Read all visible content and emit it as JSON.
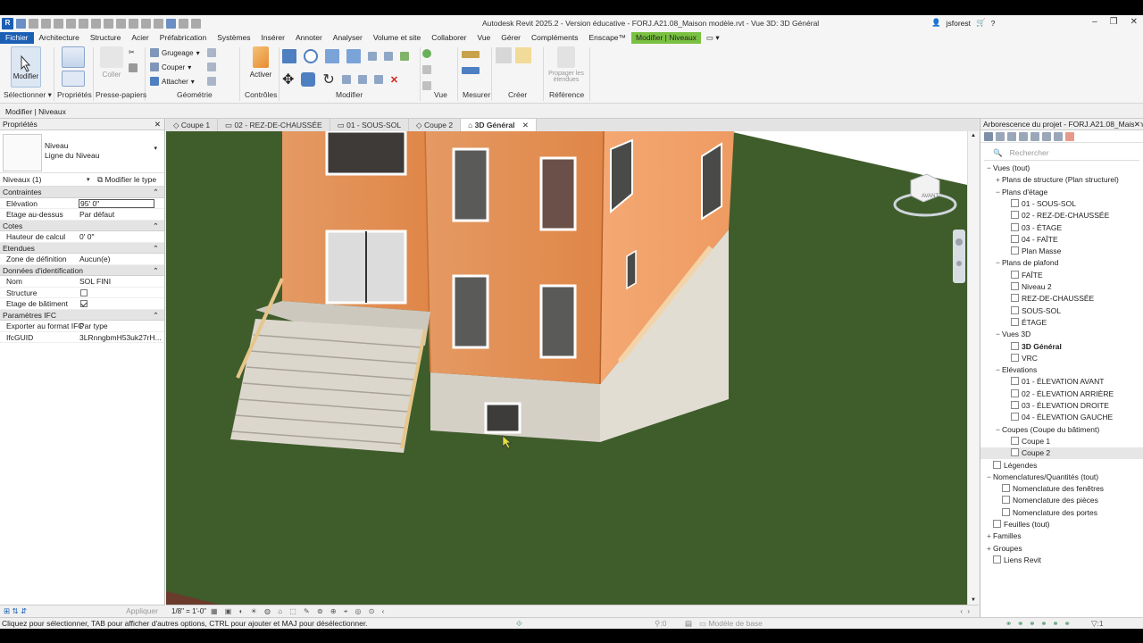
{
  "window": {
    "title": "Autodesk Revit 2025.2 - Version éducative - FORJ.A21.08_Maison modèle.rvt - Vue 3D: 3D Général",
    "user": "jsforest"
  },
  "menu": [
    "Fichier",
    "Architecture",
    "Structure",
    "Acier",
    "Préfabrication",
    "Systèmes",
    "Insérer",
    "Annoter",
    "Analyser",
    "Volume et site",
    "Collaborer",
    "Vue",
    "Gérer",
    "Compléments",
    "Enscape™",
    "Modifier | Niveaux"
  ],
  "ribbon": {
    "modify_label": "Modifier",
    "panels": [
      "Sélectionner",
      "Propriétés",
      "Presse-papiers",
      "Géométrie",
      "Contrôles",
      "Modifier",
      "Vue",
      "Mesurer",
      "Créer",
      "Référence"
    ],
    "geometry": {
      "cope": "Grugeage",
      "cut": "Couper",
      "join": "Attacher"
    },
    "activate": "Activer",
    "coller": "Coller",
    "propagate": "Propager les étendues"
  },
  "options_bar": "Modifier | Niveaux",
  "properties": {
    "title": "Propriétés",
    "type_family": "Niveau",
    "type_name": "Ligne du Niveau",
    "instance_filter": "Niveaux (1)",
    "edit_type": "Modifier le type",
    "sections": [
      {
        "name": "Contraintes",
        "rows": [
          {
            "k": "Elévation",
            "v": "95'  0\""
          },
          {
            "k": "Etage au-dessus",
            "v": "Par défaut"
          }
        ]
      },
      {
        "name": "Cotes",
        "rows": [
          {
            "k": "Hauteur de calcul",
            "v": "0'  0\""
          }
        ]
      },
      {
        "name": "Etendues",
        "rows": [
          {
            "k": "Zone de définition",
            "v": "Aucun(e)"
          }
        ]
      },
      {
        "name": "Données d'identification",
        "rows": [
          {
            "k": "Nom",
            "v": "SOL FINI"
          },
          {
            "k": "Structure",
            "v": ""
          },
          {
            "k": "Etage de bâtiment",
            "v": ""
          }
        ]
      },
      {
        "name": "Paramètres IFC",
        "rows": [
          {
            "k": "Exporter au format IFC",
            "v": "Par type"
          },
          {
            "k": "IfcGUID",
            "v": "3LRnngbmH53uk27rH..."
          }
        ]
      }
    ],
    "apply": "Appliquer"
  },
  "tabs": [
    "Coupe 1",
    "02 - REZ-DE-CHAUSSÉE",
    "01 - SOUS-SOL",
    "Coupe 2",
    "3D Général"
  ],
  "view": {
    "scale": "1/8\" = 1'-0\"",
    "cube_label": "AVANT"
  },
  "browser": {
    "title": "Arborescence du projet - FORJ.A21.08_Maison...",
    "search": "Rechercher",
    "tree": [
      {
        "t": "Vues (tout)",
        "lvl": 0,
        "ex": "−"
      },
      {
        "t": "Plans de structure (Plan structurel)",
        "lvl": 1,
        "ex": "+"
      },
      {
        "t": "Plans d'étage",
        "lvl": 1,
        "ex": "−"
      },
      {
        "t": "01 - SOUS-SOL",
        "lvl": 2,
        "ex": ""
      },
      {
        "t": "02 - REZ-DE-CHAUSSÉE",
        "lvl": 2,
        "ex": ""
      },
      {
        "t": "03 - ÉTAGE",
        "lvl": 2,
        "ex": ""
      },
      {
        "t": "04 - FAÎTE",
        "lvl": 2,
        "ex": ""
      },
      {
        "t": "Plan Masse",
        "lvl": 2,
        "ex": ""
      },
      {
        "t": "Plans de plafond",
        "lvl": 1,
        "ex": "−"
      },
      {
        "t": "FAÎTE",
        "lvl": 2,
        "ex": ""
      },
      {
        "t": "Niveau 2",
        "lvl": 2,
        "ex": ""
      },
      {
        "t": "REZ-DE-CHAUSSÉE",
        "lvl": 2,
        "ex": ""
      },
      {
        "t": "SOUS-SOL",
        "lvl": 2,
        "ex": ""
      },
      {
        "t": "ÉTAGE",
        "lvl": 2,
        "ex": ""
      },
      {
        "t": "Vues 3D",
        "lvl": 1,
        "ex": "−"
      },
      {
        "t": "3D Général",
        "lvl": 2,
        "ex": "",
        "bold": true
      },
      {
        "t": "VRC",
        "lvl": 2,
        "ex": ""
      },
      {
        "t": "Elévations",
        "lvl": 1,
        "ex": "−"
      },
      {
        "t": "01 - ÉLEVATION AVANT",
        "lvl": 2,
        "ex": ""
      },
      {
        "t": "02 - ÉLEVATION ARRIÈRE",
        "lvl": 2,
        "ex": ""
      },
      {
        "t": "03 - ÉLEVATION DROITE",
        "lvl": 2,
        "ex": ""
      },
      {
        "t": "04 - ÉLEVATION GAUCHE",
        "lvl": 2,
        "ex": ""
      },
      {
        "t": "Coupes (Coupe du bâtiment)",
        "lvl": 1,
        "ex": "−"
      },
      {
        "t": "Coupe 1",
        "lvl": 2,
        "ex": ""
      },
      {
        "t": "Coupe 2",
        "lvl": 2,
        "ex": "",
        "sel": true
      },
      {
        "t": "Légendes",
        "lvl": 0,
        "ex": ""
      },
      {
        "t": "Nomenclatures/Quantités (tout)",
        "lvl": 0,
        "ex": "−"
      },
      {
        "t": "Nomenclature des fenêtres",
        "lvl": 1,
        "ex": ""
      },
      {
        "t": "Nomenclature des pièces",
        "lvl": 1,
        "ex": ""
      },
      {
        "t": "Nomenclature des portes",
        "lvl": 1,
        "ex": ""
      },
      {
        "t": "Feuilles (tout)",
        "lvl": 0,
        "ex": ""
      },
      {
        "t": "Familles",
        "lvl": 0,
        "ex": "+"
      },
      {
        "t": "Groupes",
        "lvl": 0,
        "ex": "+"
      },
      {
        "t": "Liens Revit",
        "lvl": 0,
        "ex": ""
      }
    ]
  },
  "status": {
    "hint": "Cliquez pour sélectionner, TAB pour afficher d'autres options,  CTRL pour ajouter et MAJ pour désélectionner.",
    "model": "Modèle de base",
    "zero": ":0"
  },
  "colors": {
    "accent": "#1b5fb5",
    "context_tab": "#7ac142",
    "wall_orange": "#e8884a",
    "grass": "#3d5a28",
    "foundation": "#cfcac0"
  }
}
